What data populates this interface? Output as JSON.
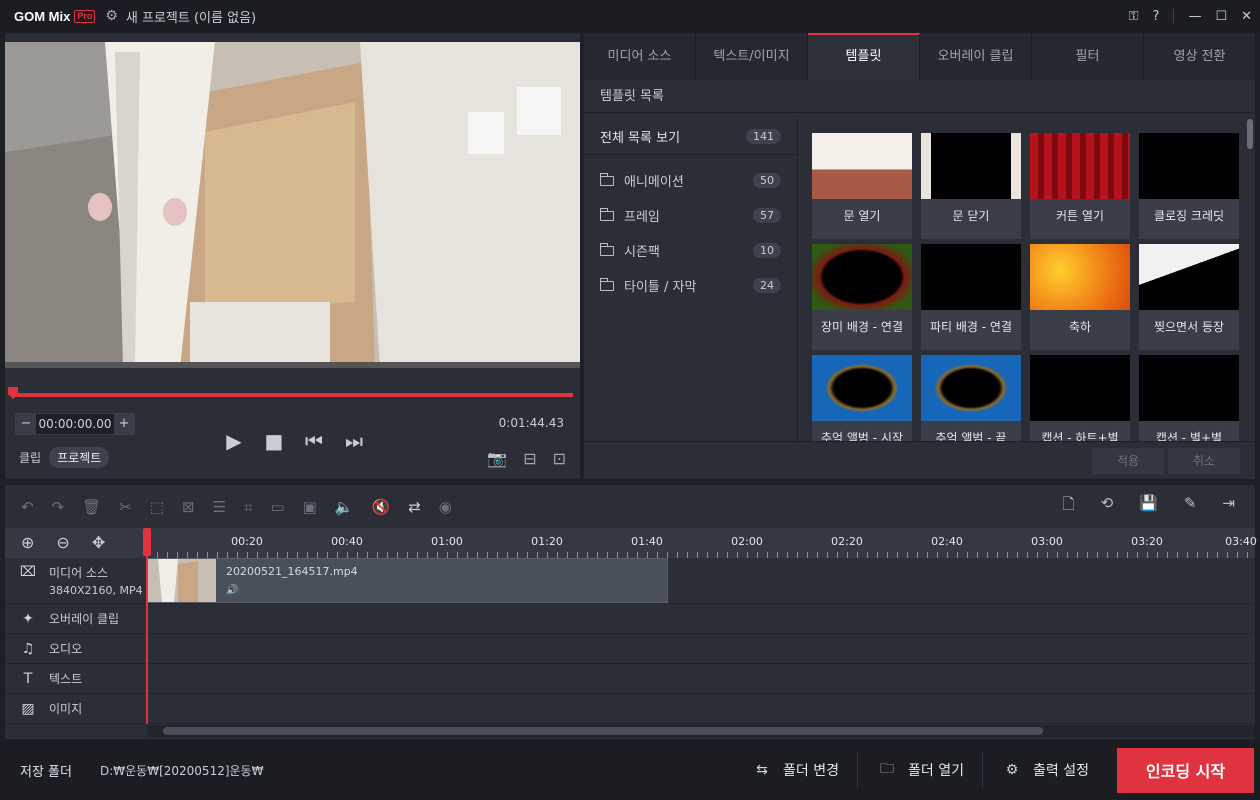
{
  "titlebar": {
    "logo_text": "GOM Mix",
    "logo_badge": "Pro",
    "project_title": "새 프로젝트 (이름 없음)"
  },
  "preview": {
    "current_time": "00:00:00.00",
    "duration": "0:01:44.43",
    "mode_clip": "클립",
    "mode_project": "프로젝트"
  },
  "panel": {
    "tabs": [
      "미디어 소스",
      "텍스트/이미지",
      "템플릿",
      "오버레이 클립",
      "필터",
      "영상 전환"
    ],
    "active_tab": "템플릿",
    "subheader": "템플릿 목록",
    "all_label": "전체 목록 보기",
    "all_count": "141",
    "categories": [
      {
        "label": "애니메이션",
        "count": "50"
      },
      {
        "label": "프레임",
        "count": "57"
      },
      {
        "label": "시즌팩",
        "count": "10"
      },
      {
        "label": "타이틀 / 자막",
        "count": "24"
      }
    ],
    "templates": [
      "문 열기",
      "문 닫기",
      "커튼 열기",
      "클로징 크레딧",
      "장미 배경 - 연결",
      "파티 배경 - 연결",
      "축하",
      "찢으면서 등장",
      "추억 앨범 - 시작",
      "추억 앨범 - 끝",
      "캡션 - 하트+별",
      "캡션 - 별+별"
    ],
    "apply_label": "적용",
    "cancel_label": "취소"
  },
  "timeline": {
    "ticks": [
      "00:20",
      "00:40",
      "01:00",
      "01:20",
      "01:40",
      "02:00",
      "02:20",
      "02:40",
      "03:00",
      "03:20",
      "03:40"
    ],
    "tracks": [
      {
        "label": "미디어 소스",
        "sub": "3840X2160, MP4",
        "icon": "film-icon"
      },
      {
        "label": "오버레이 클립",
        "sub": "",
        "icon": "sparkle-icon"
      },
      {
        "label": "오디오",
        "sub": "",
        "icon": "music-icon"
      },
      {
        "label": "텍스트",
        "sub": "",
        "icon": "text-icon"
      },
      {
        "label": "이미지",
        "sub": "",
        "icon": "image-icon"
      }
    ],
    "clip_name": "20200521_164517.mp4"
  },
  "bottombar": {
    "save_folder_label": "저장 폴더",
    "save_path": "D:₩운동₩[20200512]운동₩",
    "change_folder": "폴더 변경",
    "open_folder": "폴더 열기",
    "output_settings": "출력 설정",
    "encode": "인코딩 시작"
  }
}
